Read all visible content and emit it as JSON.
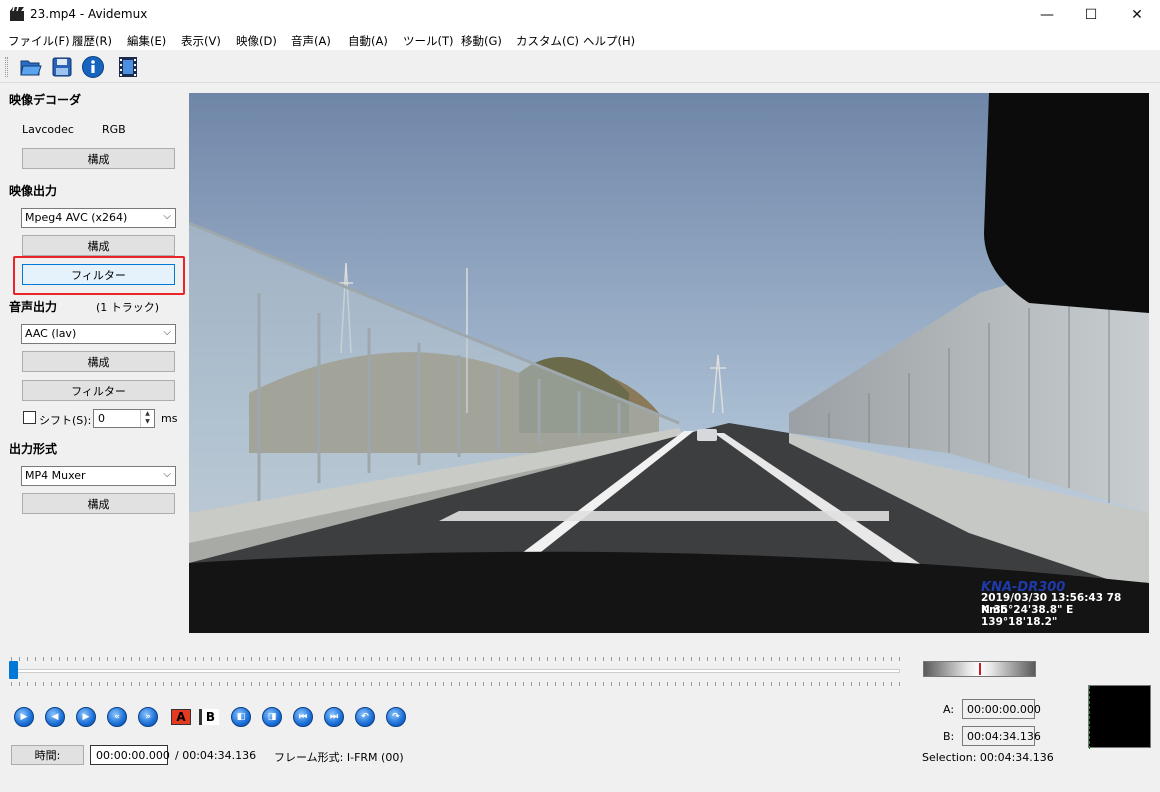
{
  "window": {
    "title": "23.mp4 - Avidemux",
    "min": "—",
    "max": "☐",
    "close": "✕"
  },
  "menu": [
    "ファイル(F)",
    "履歴(R)",
    "編集(E)",
    "表示(V)",
    "映像(D)",
    "音声(A)",
    "自動(A)",
    "ツール(T)",
    "移動(G)",
    "カスタム(C)",
    "ヘルプ(H)"
  ],
  "toolbar": {
    "icons": [
      "open-folder-icon",
      "save-disk-icon",
      "info-icon",
      "film-icon"
    ]
  },
  "video_decoder": {
    "title": "映像デコーダ",
    "codec": "Lavcodec",
    "format": "RGB",
    "configure": "構成"
  },
  "video_output": {
    "title": "映像出力",
    "codec": "Mpeg4 AVC (x264)",
    "configure": "構成",
    "filters": "フィルター"
  },
  "audio_output": {
    "title": "音声出力",
    "tracks": "(1 トラック)",
    "codec": "AAC (lav)",
    "configure": "構成",
    "filters": "フィルター",
    "shift_label": "シフト(S):",
    "shift_value": "0",
    "shift_unit": "ms"
  },
  "output_format": {
    "title": "出力形式",
    "muxer": "MP4 Muxer",
    "configure": "構成"
  },
  "video_overlay": {
    "brand": "KNA-DR300",
    "line1": "2019/03/30 13:56:43  78 Kmh",
    "line2": "N 35°24'38.8\"  E 139°18'18.2\""
  },
  "timeline": {
    "position": 0.0
  },
  "transport": {
    "buttons": [
      "play-icon",
      "previous-frame-icon",
      "next-frame-icon",
      "previous-keyframe-icon",
      "next-keyframe-icon",
      "set-marker-a-icon",
      "set-marker-b-icon",
      "previous-black-icon",
      "next-black-icon",
      "go-to-marker-a-icon",
      "go-to-marker-b-icon",
      "first-frame-icon",
      "last-frame-icon"
    ],
    "marker_a_glyph": "A",
    "marker_b_glyph": "B"
  },
  "time": {
    "label": "時間:",
    "current": "00:00:00.000",
    "total": "/ 00:04:34.136",
    "frame_type": "フレーム形式: I-FRM (00)"
  },
  "selection": {
    "a_label": "A:",
    "a_value": "00:00:00.000",
    "b_label": "B:",
    "b_value": "00:04:34.136",
    "selection": "Selection: 00:04:34.136"
  }
}
